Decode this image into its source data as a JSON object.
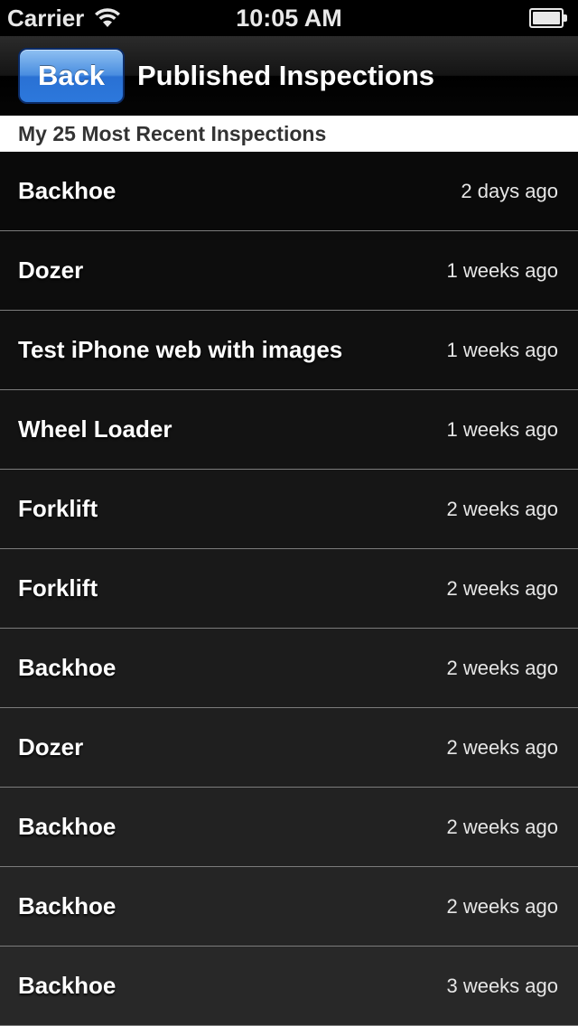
{
  "status_bar": {
    "carrier": "Carrier",
    "time": "10:05 AM",
    "wifi_icon": "wifi-icon",
    "battery_icon": "battery-icon"
  },
  "nav": {
    "back_label": "Back",
    "title": "Published Inspections"
  },
  "section": {
    "header": "My 25 Most Recent Inspections"
  },
  "inspections": [
    {
      "title": "Backhoe",
      "time": "2 days ago"
    },
    {
      "title": "Dozer",
      "time": "1 weeks ago"
    },
    {
      "title": "Test iPhone web with images",
      "time": "1 weeks ago"
    },
    {
      "title": "Wheel Loader",
      "time": "1 weeks ago"
    },
    {
      "title": "Forklift",
      "time": "2 weeks ago"
    },
    {
      "title": "Forklift",
      "time": "2 weeks ago"
    },
    {
      "title": "Backhoe",
      "time": "2 weeks ago"
    },
    {
      "title": "Dozer",
      "time": "2 weeks ago"
    },
    {
      "title": "Backhoe",
      "time": "2 weeks ago"
    },
    {
      "title": "Backhoe",
      "time": "2 weeks ago"
    },
    {
      "title": "Backhoe",
      "time": "3 weeks ago"
    }
  ],
  "colors": {
    "row_dark": "#0a0a0a",
    "row_light": "#282828",
    "accent": "#3a7fdc"
  }
}
